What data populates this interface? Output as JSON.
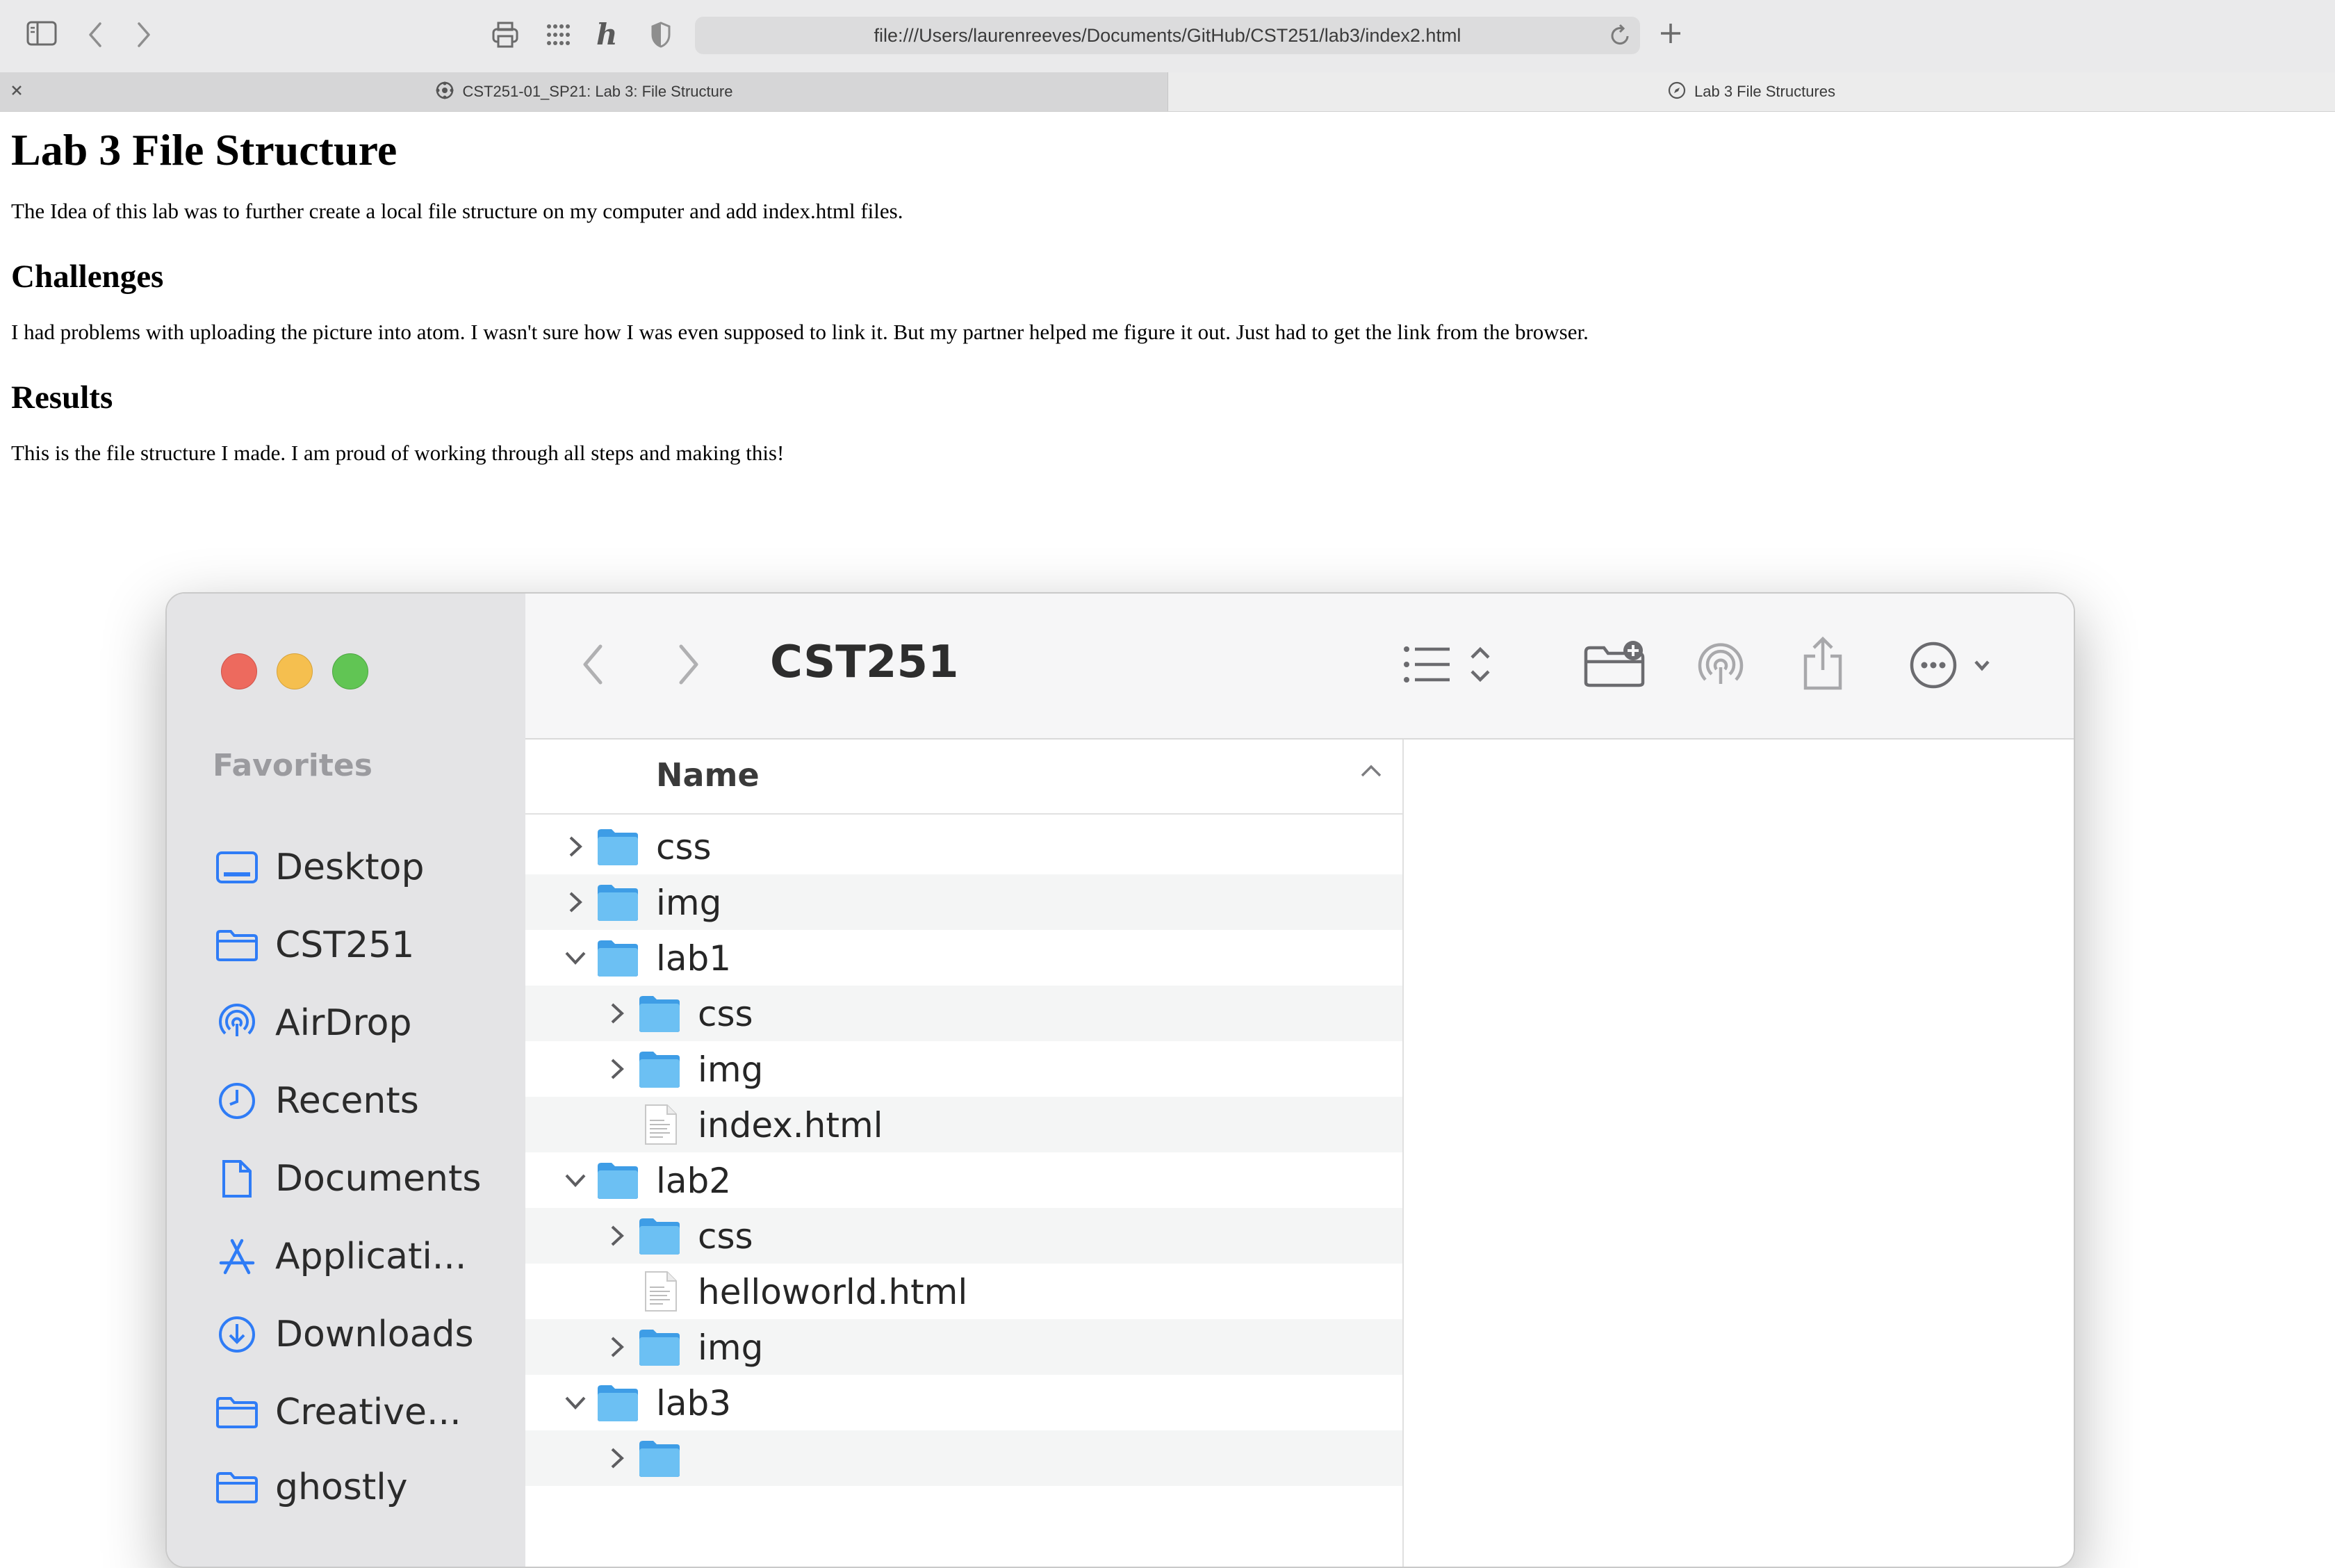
{
  "browser": {
    "address": "file:///Users/laurenreeves/Documents/GitHub/CST251/lab3/index2.html",
    "tabs": [
      {
        "label": "CST251-01_SP21: Lab 3: File Structure",
        "active": true
      },
      {
        "label": "Lab 3 File Structures",
        "active": false
      }
    ]
  },
  "page": {
    "title": "Lab 3 File Structure",
    "intro": "The Idea of this lab was to further create a local file structure on my computer and add index.html files.",
    "challenges_heading": "Challenges",
    "challenges_text": "I had problems with uploading the picture into atom. I wasn't sure how I was even supposed to link it. But my partner helped me figure it out. Just had to get the link from the browser.",
    "results_heading": "Results",
    "results_text": "This is the file structure I made. I am proud of working through all steps and making this!"
  },
  "finder": {
    "title": "CST251",
    "favorites_label": "Favorites",
    "sidebar": [
      {
        "label": "Desktop",
        "icon": "desktop-icon"
      },
      {
        "label": "CST251",
        "icon": "folder-icon"
      },
      {
        "label": "AirDrop",
        "icon": "airdrop-icon"
      },
      {
        "label": "Recents",
        "icon": "clock-icon"
      },
      {
        "label": "Documents",
        "icon": "document-icon"
      },
      {
        "label": "Applicati...",
        "icon": "applications-icon"
      },
      {
        "label": "Downloads",
        "icon": "download-icon"
      },
      {
        "label": "Creative...",
        "icon": "folder-icon"
      },
      {
        "label": "ghostly",
        "icon": "folder-icon"
      }
    ],
    "column_name": "Name",
    "rows": [
      {
        "label": "css",
        "type": "folder",
        "depth": 0,
        "expanded": false
      },
      {
        "label": "img",
        "type": "folder",
        "depth": 0,
        "expanded": false
      },
      {
        "label": "lab1",
        "type": "folder",
        "depth": 0,
        "expanded": true
      },
      {
        "label": "css",
        "type": "folder",
        "depth": 1,
        "expanded": false
      },
      {
        "label": "img",
        "type": "folder",
        "depth": 1,
        "expanded": false
      },
      {
        "label": "index.html",
        "type": "file",
        "depth": 1
      },
      {
        "label": "lab2",
        "type": "folder",
        "depth": 0,
        "expanded": true
      },
      {
        "label": "css",
        "type": "folder",
        "depth": 1,
        "expanded": false
      },
      {
        "label": "helloworld.html",
        "type": "file",
        "depth": 1
      },
      {
        "label": "img",
        "type": "folder",
        "depth": 1,
        "expanded": false
      },
      {
        "label": "lab3",
        "type": "folder",
        "depth": 0,
        "expanded": true
      },
      {
        "label": "",
        "type": "folder",
        "depth": 1,
        "expanded": false
      }
    ]
  },
  "colors": {
    "finder_accent": "#2f7cf6",
    "folder_blue": "#5eb4f0",
    "traffic_red": "#ed6a5e",
    "traffic_yellow": "#f5bf4f",
    "traffic_green": "#61c554"
  }
}
